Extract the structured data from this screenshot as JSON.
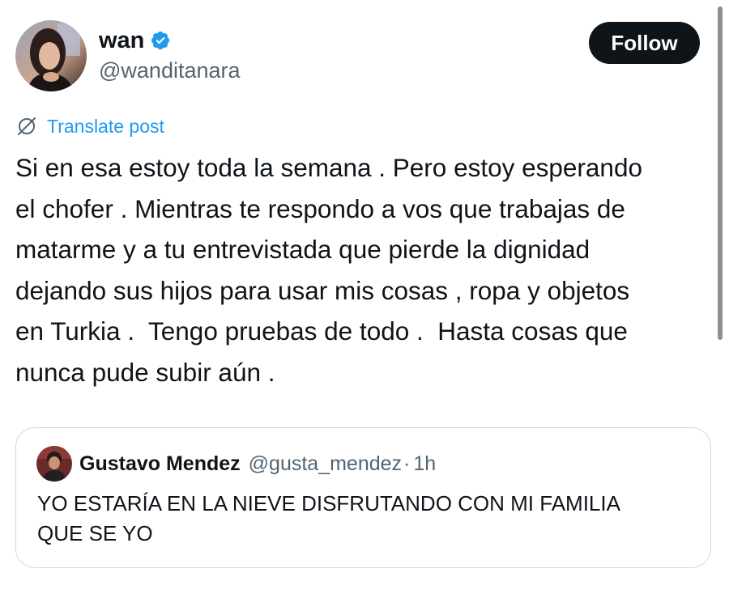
{
  "post": {
    "author": {
      "display_name": "wan",
      "handle": "@wanditanara",
      "verified": true,
      "avatar_icon": "profile-photo"
    },
    "follow_label": "Follow",
    "translate_label": "Translate post",
    "text": "Si en esa estoy toda la semana . Pero estoy esperando\nel chofer . Mientras te respondo a vos que trabajas de\nmatarme y a tu entrevistada que pierde la dignidad\ndejando sus hijos para usar mis cosas , ropa y objetos\nen Turkia .  Tengo pruebas de todo .  Hasta cosas que\nnunca pude subir aún ."
  },
  "quoted_post": {
    "author": {
      "display_name": "Gustavo Mendez",
      "handle": "@gusta_mendez",
      "separator": "·",
      "time": "1h",
      "avatar_icon": "profile-photo"
    },
    "text": "YO ESTARÍA EN LA NIEVE DISFRUTANDO CON MI FAMILIA\nQUE SE YO"
  },
  "colors": {
    "link_blue": "#1d9bf0",
    "verified_blue": "#1d9bf0",
    "follow_bg": "#0f1419",
    "text_primary": "#0f1419",
    "text_secondary": "#536471",
    "border": "#cfd9de"
  }
}
